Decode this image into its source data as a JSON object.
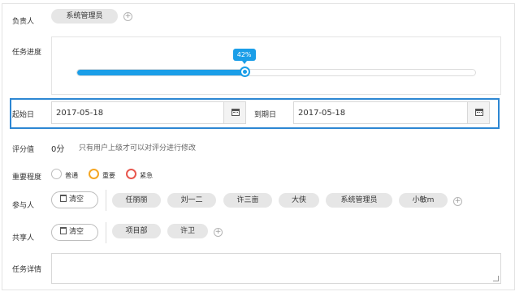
{
  "owner": {
    "label": "负责人",
    "tag": "系统管理员"
  },
  "progress": {
    "label": "任务进度",
    "percent": 42,
    "percent_text": "42%"
  },
  "dates": {
    "start_label": "起始日",
    "start_value": "2017-05-18",
    "end_label": "到期日",
    "end_value": "2017-05-18"
  },
  "rating": {
    "label": "评分值",
    "value": "0分",
    "note": "只有用户上级才可以对评分进行修改"
  },
  "importance": {
    "label": "重要程度",
    "options": [
      {
        "label": "普通",
        "color": "#bdbdbd"
      },
      {
        "label": "重要",
        "color": "#f5a623"
      },
      {
        "label": "紧急",
        "color": "#e8574e"
      }
    ]
  },
  "participants": {
    "label": "参与人",
    "clear_label": "清空",
    "tags": [
      "任丽丽",
      "刘一二",
      "许三亩",
      "大侠",
      "系统管理员",
      "小敏m"
    ]
  },
  "sharers": {
    "label": "共享人",
    "clear_label": "清空",
    "tags": [
      "项目部",
      "许卫"
    ]
  },
  "details": {
    "label": "任务详情",
    "value": ""
  },
  "colors": {
    "accent": "#1a9ee8",
    "highlight_outline": "#2d87d3"
  }
}
